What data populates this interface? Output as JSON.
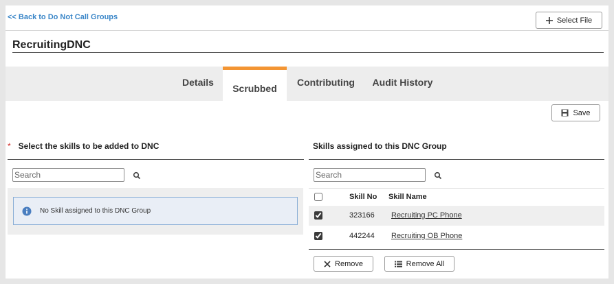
{
  "header": {
    "back_link": "<< Back to Do Not Call Groups",
    "select_file_label": "Select File"
  },
  "group_title": "RecruitingDNC",
  "tabs": [
    {
      "label": "Details",
      "active": false
    },
    {
      "label": "Scrubbed",
      "active": true
    },
    {
      "label": "Contributing",
      "active": false
    },
    {
      "label": "Audit History",
      "active": false
    }
  ],
  "save_label": "Save",
  "left": {
    "required_mark": "*",
    "heading": "Select the skills to be added to DNC",
    "search_placeholder": "Search",
    "empty_message": "No Skill assigned to this DNC Group"
  },
  "right": {
    "heading": "Skills assigned to this DNC Group",
    "search_placeholder": "Search",
    "columns": {
      "skill_no": "Skill No",
      "skill_name": "Skill Name"
    },
    "rows": [
      {
        "skill_no": "323166",
        "skill_name": "Recruiting PC Phone",
        "checked": true
      },
      {
        "skill_no": "442244",
        "skill_name": "Recruiting OB Phone",
        "checked": true
      }
    ],
    "remove_label": "Remove",
    "remove_all_label": "Remove All"
  },
  "colors": {
    "accent_tab": "#f39533",
    "link": "#3a86c8",
    "required": "#d0312d",
    "info_border": "#8aaed6"
  }
}
